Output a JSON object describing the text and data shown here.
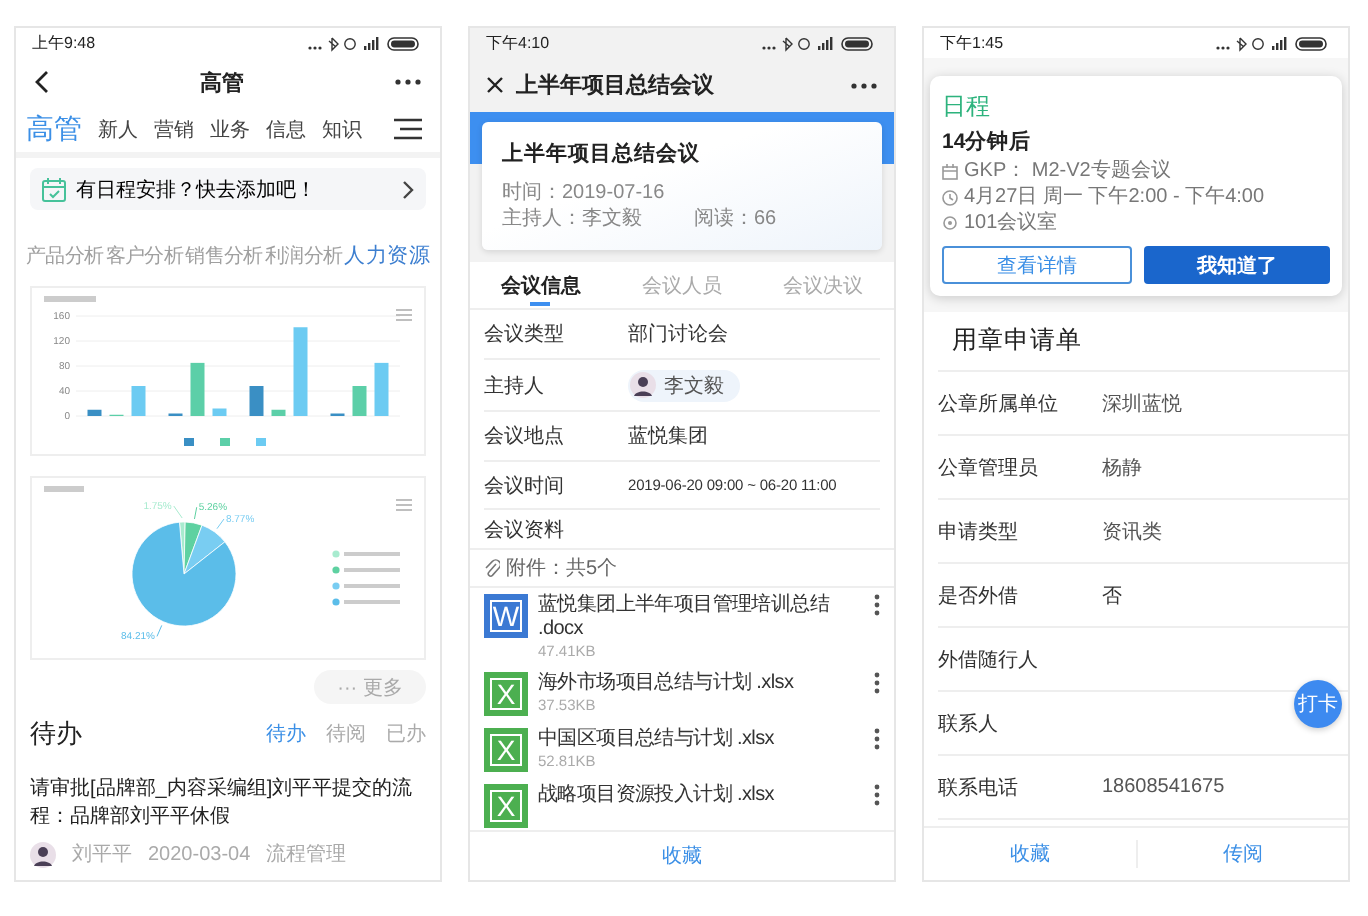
{
  "home_screen": {
    "status_bar": {
      "time": "上午9:48"
    },
    "title": "高管",
    "tabs": [
      {
        "label": "高管",
        "selected": true
      },
      {
        "label": "新人",
        "selected": false
      },
      {
        "label": "营销",
        "selected": false
      },
      {
        "label": "业务",
        "selected": false
      },
      {
        "label": "信息",
        "selected": false
      },
      {
        "label": "知识",
        "selected": false
      }
    ],
    "banner": "有日程安排？快去添加吧！",
    "analysis_tabs": [
      {
        "label": "产品分析",
        "selected": false
      },
      {
        "label": "客户分析",
        "selected": false
      },
      {
        "label": "销售分析",
        "selected": false
      },
      {
        "label": "利润分析",
        "selected": false
      },
      {
        "label": "人力资源",
        "selected": true
      }
    ],
    "bar_chart": {
      "chart_data": {
        "type": "bar",
        "grid": true,
        "ylim": [
          0,
          160
        ],
        "yticks": [
          0,
          40,
          80,
          120,
          160
        ],
        "series": [
          {
            "color": "#3a8fc4",
            "values": [
              10,
              4,
              48,
              4
            ]
          },
          {
            "color": "#5ccfa8",
            "values": [
              2,
              85,
              10,
              48
            ]
          },
          {
            "color": "#6ccbf2",
            "values": [
              48,
              12,
              142,
              85
            ]
          }
        ]
      }
    },
    "pie_chart": {
      "chart_data": {
        "type": "pie",
        "values": [
          1.75,
          5.26,
          8.77,
          84.21
        ],
        "value_labels": [
          "1.75%",
          "5.26%",
          "8.77%",
          "84.21%"
        ]
      }
    },
    "more": "··· 更多",
    "todo": {
      "title": "待办",
      "tabs": [
        {
          "label": "待办",
          "selected": true
        },
        {
          "label": "待阅",
          "selected": false
        },
        {
          "label": "已办",
          "selected": false
        }
      ],
      "items": [
        {
          "text": "请审批[品牌部_内容采编组]刘平平提交的流程：品牌部刘平平休假",
          "author": "刘平平",
          "date": "2020-03-04",
          "category": "流程管理"
        }
      ]
    }
  },
  "meeting_screen": {
    "status_bar": {
      "time": "下午4:10"
    },
    "title": "上半年项目总结会议",
    "card": {
      "title": "上半年项目总结会议",
      "time": "时间：2019-07-16",
      "host": "主持人：李文毅",
      "reads": "阅读：66"
    },
    "tabs": [
      {
        "label": "会议信息",
        "selected": true
      },
      {
        "label": "会议人员",
        "selected": false
      },
      {
        "label": "会议决议",
        "selected": false
      }
    ],
    "fields": [
      {
        "kind": "text",
        "label": "会议类型",
        "value": "部门讨论会"
      },
      {
        "kind": "person",
        "label": "主持人",
        "value": "李文毅"
      },
      {
        "kind": "text",
        "label": "会议地点",
        "value": "蓝悦集团"
      },
      {
        "kind": "time",
        "label": "会议时间",
        "value": "2019-06-20 09:00 ~ 06-20 11:00"
      },
      {
        "kind": "heading",
        "label": "会议资料"
      }
    ],
    "attachments": {
      "summary": "附件：共5个",
      "files": [
        {
          "kind": "word",
          "badge": "W",
          "name": "蓝悦集团上半年项目管理培训总结 .docx",
          "size": "47.41KB"
        },
        {
          "kind": "excel",
          "badge": "X",
          "name": "海外市场项目总结与计划 .xlsx",
          "size": "37.53KB"
        },
        {
          "kind": "excel",
          "badge": "X",
          "name": "中国区项目总结与计划 .xlsx",
          "size": "52.81KB"
        },
        {
          "kind": "excel",
          "badge": "X",
          "name": "战略项目资源投入计划 .xlsx"
        }
      ]
    },
    "actions": [
      "收藏"
    ]
  },
  "seal_screen": {
    "status_bar": {
      "time": "下午1:45"
    },
    "reminder": {
      "title": "日程",
      "due": "14分钟后",
      "subject": "GKP： M2-V2专题会议",
      "time": "4月27日 周一 下午2:00 - 下午4:00",
      "location": "101会议室",
      "buttons": [
        {
          "kind": "secondary",
          "label": "查看详情"
        },
        {
          "kind": "primary",
          "label": "我知道了"
        }
      ]
    },
    "form_title": "用章申请单",
    "fields": [
      {
        "label": "公章所属单位",
        "value": "深圳蓝悦"
      },
      {
        "label": "公章管理员",
        "value": "杨静"
      },
      {
        "label": "申请类型",
        "value": "资讯类"
      },
      {
        "label": "是否外借",
        "value": "否"
      },
      {
        "label": "外借随行人"
      },
      {
        "label": "联系人"
      },
      {
        "label": "联系电话",
        "value": "18608541675"
      }
    ],
    "float_button": "打卡",
    "actions": [
      "收藏",
      "传阅"
    ]
  }
}
